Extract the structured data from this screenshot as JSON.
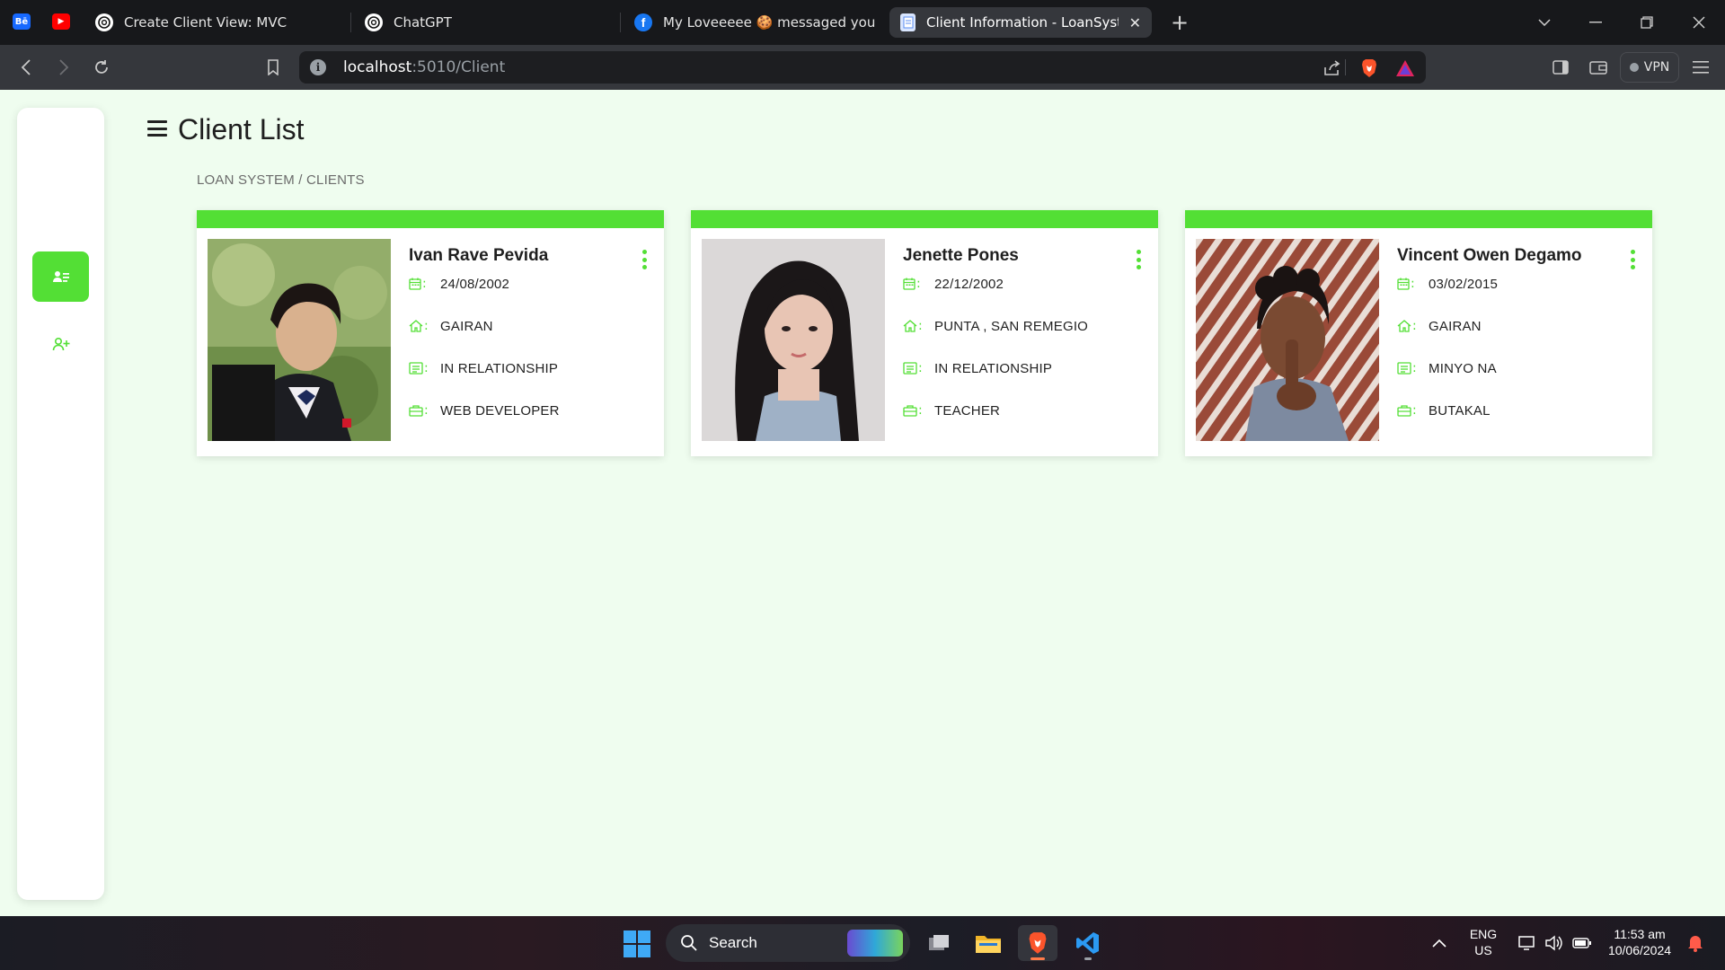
{
  "browser": {
    "pinned_tabs": [
      {
        "name": "behance",
        "label": "Bē",
        "color": "#1769ff"
      },
      {
        "name": "youtube",
        "label": "▶",
        "color": "#ff0000"
      }
    ],
    "tabs": [
      {
        "title": "Create Client View: MVC",
        "favicon": "chatgpt-icon",
        "active": false
      },
      {
        "title": "ChatGPT",
        "favicon": "chatgpt-icon",
        "active": false
      },
      {
        "title": "My Loveeeee 🍪 messaged you",
        "favicon": "facebook-icon",
        "active": false
      },
      {
        "title": "Client Information - LoanSystem",
        "favicon": "page-icon",
        "active": true
      }
    ],
    "url_host": "localhost",
    "url_path": ":5010/Client",
    "vpn_label": "VPN"
  },
  "page": {
    "title": "Client List",
    "breadcrumb": "LOAN SYSTEM / CLIENTS",
    "accent_color": "#53df35",
    "background_color": "#effdef",
    "sidebar": [
      {
        "name": "client-list",
        "icon": "address-card-icon",
        "active": true
      },
      {
        "name": "add-client",
        "icon": "user-plus-icon",
        "active": false
      }
    ]
  },
  "clients": [
    {
      "name": "Ivan Rave Pevida",
      "birthdate": "24/08/2002",
      "address": "GAIRAN",
      "status": "IN RELATIONSHIP",
      "occupation": "WEB DEVELOPER"
    },
    {
      "name": "Jenette Pones",
      "birthdate": "22/12/2002",
      "address": "PUNTA , SAN REMEGIO",
      "status": "IN RELATIONSHIP",
      "occupation": "TEACHER"
    },
    {
      "name": "Vincent Owen Degamo",
      "birthdate": "03/02/2015",
      "address": "GAIRAN",
      "status": "MINYO NA",
      "occupation": "BUTAKAL"
    }
  ],
  "taskbar": {
    "search_label": "Search",
    "language_top": "ENG",
    "language_bottom": "US",
    "time": "11:53 am",
    "date": "10/06/2024"
  }
}
